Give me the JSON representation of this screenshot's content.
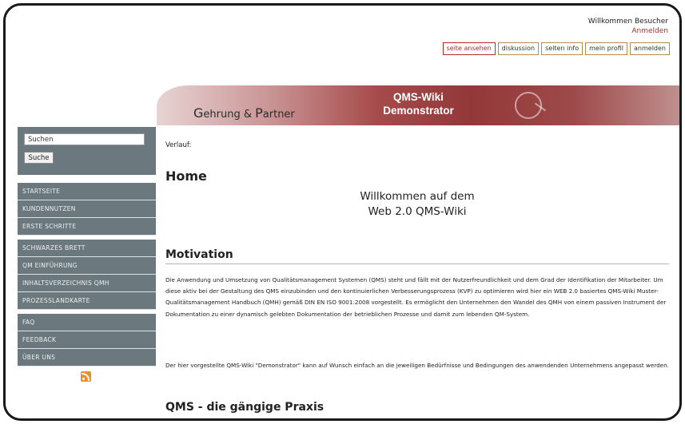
{
  "user": {
    "welcome": "Willkommen Besucher",
    "login": "Anmelden"
  },
  "tabs": [
    "seite ansehen",
    "diskussion",
    "seiten info",
    "mein profil",
    "anmelden"
  ],
  "banner": {
    "brand_g": "G",
    "brand_rest1": "ehrung & ",
    "brand_p": "P",
    "brand_rest2": "artner",
    "title_line1": "QMS-Wiki",
    "title_line2": "Demonstrator"
  },
  "sidebar": {
    "search_value": "Suchen",
    "search_button": "Suche",
    "group1": [
      "STARTSEITE",
      "KUNDENNUTZEN",
      "ERSTE SCHRITTE"
    ],
    "group2": [
      "SCHWARZES BRETT",
      "QM EINFÜHRUNG",
      "INHALTSVERZEICHNIS QMH",
      "PROZESSLANDKARTE"
    ],
    "group3": [
      "FAQ",
      "FEEDBACK",
      "ÜBER UNS"
    ],
    "rss_icon": "rss-feed-icon"
  },
  "content": {
    "history": "Verlauf:",
    "page_title": "Home",
    "welcome_line1": "Willkommen auf dem",
    "welcome_line2": "Web 2.0 QMS-Wiki",
    "motivation_title": "Motivation",
    "motivation_p1": "Die Anwendung und Umsetzung von Qualitätsmanagement Systemen (QMS) steht und fällt mit der Nutzerfreundlichkeit und dem Grad der Identifikation der Mitarbeiter. Um diese aktiv bei der Gestaltung des QMS einzubinden und den kontinuierlichen Verbesserungsprozess (KVP) zu optimieren wird hier ein WEB 2.0 basiertes QMS-Wiki Muster-Qualitätsmanagement Handbuch (QMH) gemäß DIN EN ISO 9001:2008 vorgestellt. Es ermöglicht den Unternehmen den Wandel des QMH von einem passiven Instrument der Dokumentation zu einer dynamisch gelebten Dokumentation der betrieblichen Prozesse und damit zum lebenden QM-System.",
    "motivation_p2": "Der hier vorgestellte QMS-Wiki \"Demonstrator\" kann auf Wunsch einfach an die jeweiligen Bedürfnisse und Bedingungen des anwendenden Unternehmens angepasst werden.",
    "praxis_title": "QMS - die gängige Praxis"
  },
  "colors": {
    "accent_red": "#a33a3a",
    "sidebar_gray": "#6b787d"
  }
}
